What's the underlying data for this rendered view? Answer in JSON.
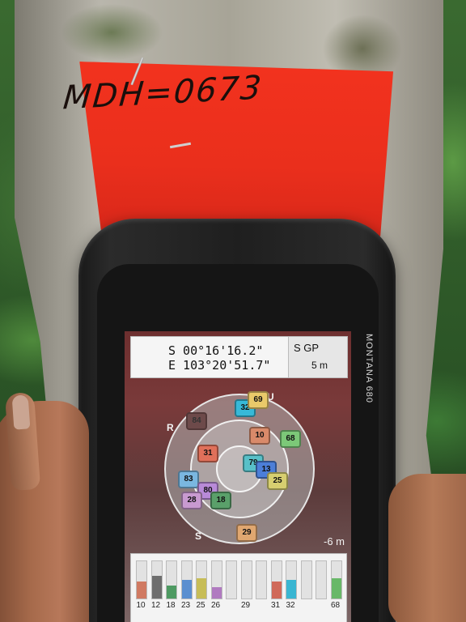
{
  "tag": {
    "text": "MDH=0673"
  },
  "device": {
    "brand": "MONTANA 680"
  },
  "screen": {
    "latitude": "S 00°16'16.2\"",
    "longitude": "E 103°20'51.7\"",
    "status": "S GP",
    "status_accuracy": "5 m",
    "accuracy": "-6 m"
  },
  "skyplot": {
    "directions": {
      "up": "U",
      "right": "R",
      "bottom": "S"
    },
    "satellites": [
      {
        "id": "32",
        "color": "#37b9d8"
      },
      {
        "id": "69",
        "color": "#e9c96a"
      },
      {
        "id": "84",
        "color": "#6d4a4a"
      },
      {
        "id": "10",
        "color": "#d98a6a"
      },
      {
        "id": "68",
        "color": "#7cc878"
      },
      {
        "id": "31",
        "color": "#e0705a"
      },
      {
        "id": "79",
        "color": "#58c0c8"
      },
      {
        "id": "13",
        "color": "#4c7ed8"
      },
      {
        "id": "25",
        "color": "#d7cf70"
      },
      {
        "id": "83",
        "color": "#7ab7e0"
      },
      {
        "id": "80",
        "color": "#b88ad8"
      },
      {
        "id": "28",
        "color": "#c89ad0"
      },
      {
        "id": "18",
        "color": "#5aa06a"
      },
      {
        "id": "29",
        "color": "#e0a770"
      }
    ]
  },
  "signal_bars": [
    {
      "label": "10",
      "level": 0.45,
      "color": "#d07a62"
    },
    {
      "label": "12",
      "level": 0.6,
      "color": "#6e6e6e"
    },
    {
      "label": "18",
      "level": 0.35,
      "color": "#4e9a62"
    },
    {
      "label": "23",
      "level": 0.5,
      "color": "#5b8fd0"
    },
    {
      "label": "25",
      "level": 0.55,
      "color": "#c7bd57"
    },
    {
      "label": "26",
      "level": 0.3,
      "color": "#b07ac0"
    },
    {
      "label": "",
      "level": 0.0,
      "color": "#cccccc"
    },
    {
      "label": "29",
      "level": 0.0,
      "color": "#cccccc"
    },
    {
      "label": "",
      "level": 0.0,
      "color": "#cccccc"
    },
    {
      "label": "31",
      "level": 0.45,
      "color": "#d06a5a"
    },
    {
      "label": "32",
      "level": 0.5,
      "color": "#3ab6d2"
    },
    {
      "label": "",
      "level": 0.0,
      "color": "#cccccc"
    },
    {
      "label": "",
      "level": 0.0,
      "color": "#cccccc"
    },
    {
      "label": "68",
      "level": 0.55,
      "color": "#68b868"
    }
  ]
}
